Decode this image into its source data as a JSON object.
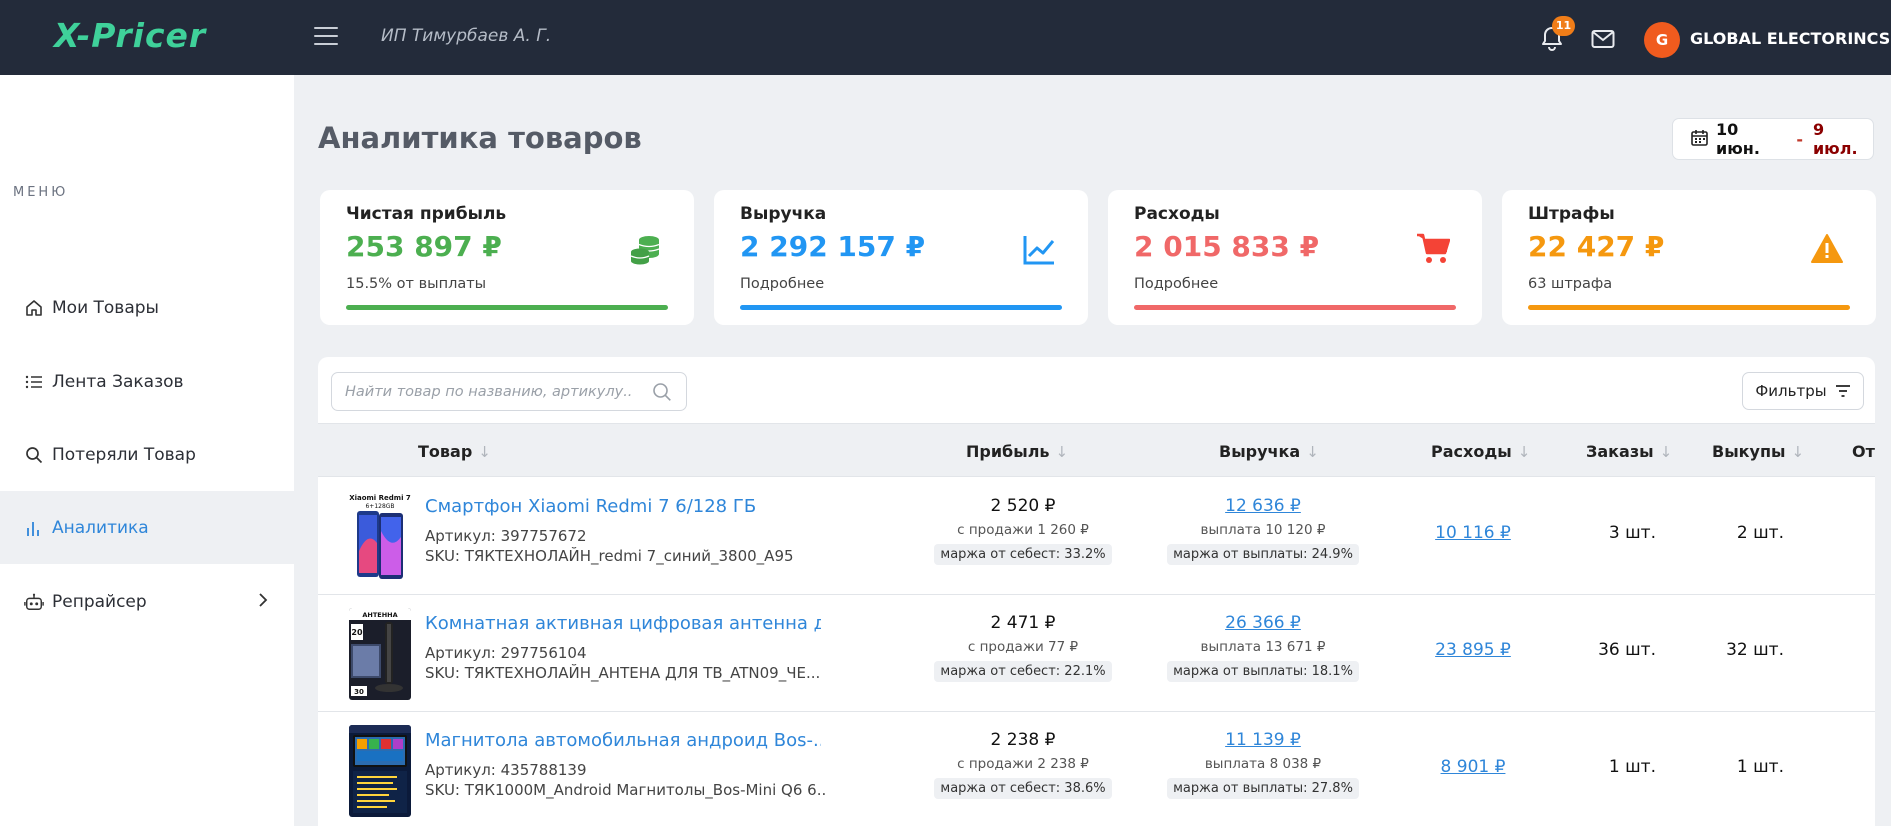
{
  "header": {
    "logo": "X-Pricer",
    "company": "ИП Тимурбаев А. Г.",
    "notifications_count": "11",
    "avatar_letter": "G",
    "user_name": "GLOBAL ELECTORINCS"
  },
  "sidebar": {
    "caption": "МЕНЮ",
    "items": [
      {
        "label": "Мои Товары",
        "icon": "home-icon"
      },
      {
        "label": "Лента Заказов",
        "icon": "list-icon"
      },
      {
        "label": "Потеряли Товар",
        "icon": "search-icon"
      },
      {
        "label": "Аналитика",
        "icon": "bar-chart-icon",
        "active": true
      },
      {
        "label": "Репрайсер",
        "icon": "robot-icon"
      }
    ]
  },
  "page": {
    "title": "Аналитика товаров",
    "date_from": "10 июн.",
    "date_sep": "-",
    "date_to": "9 июл."
  },
  "cards": [
    {
      "title": "Чистая прибыль",
      "value": "253 897 ₽",
      "sub": "15.5% от выплаты",
      "color": "#4caf50",
      "icon": "coins-icon"
    },
    {
      "title": "Выручка",
      "value": "2 292 157 ₽",
      "sub": "Подробнее",
      "color": "#2196f3",
      "icon": "line-chart-icon"
    },
    {
      "title": "Расходы",
      "value": "2 015 833 ₽",
      "sub": "Подробнее",
      "color": "#f06868",
      "icon": "cart-icon"
    },
    {
      "title": "Штрафы",
      "value": "22 427 ₽",
      "sub": "63 штрафа",
      "color": "#f5980f",
      "icon": "warning-icon"
    }
  ],
  "search": {
    "placeholder": "Найти товар по названию, артикулу..."
  },
  "filters_label": "Фильтры",
  "table": {
    "columns": [
      "Товар",
      "Прибыль",
      "Выручка",
      "Расходы",
      "Заказы",
      "Выкупы",
      "Отк"
    ],
    "rows": [
      {
        "name": "Смартфон Xiaomi Redmi 7 6/128 ГБ",
        "article": "Артикул: 397757672",
        "sku": "SKU: ТЯКТЕХНОЛАЙН_redmi 7_синий_3800_А95",
        "profit": "2 520 ₽",
        "profit_sale": "с продажи 1 260 ₽",
        "profit_margin": "маржа от себест: 33.2%",
        "revenue": "12 636 ₽",
        "revenue_payout": "выплата 10 120 ₽",
        "revenue_margin": "маржа от выплаты: 24.9%",
        "expenses": "10 116 ₽",
        "orders": "3 шт.",
        "buyouts": "2 шт."
      },
      {
        "name": "Комнатная активная цифровая антенна д...",
        "article": "Артикул: 297756104",
        "sku": "SKU: ТЯКТЕХНОЛАЙН_АНТЕНА ДЛЯ ТВ_ATN09_ЧЕ...",
        "profit": "2 471 ₽",
        "profit_sale": "с продажи 77 ₽",
        "profit_margin": "маржа от себест: 22.1%",
        "revenue": "26 366 ₽",
        "revenue_payout": "выплата 13 671 ₽",
        "revenue_margin": "маржа от выплаты: 18.1%",
        "expenses": "23 895 ₽",
        "orders": "36 шт.",
        "buyouts": "32 шт."
      },
      {
        "name": "Магнитола автомобильная андроид Bos-...",
        "article": "Артикул: 435788139",
        "sku": "SKU: ТЯК1000М_Android Магнитолы_Bos-Mini Q6 6...",
        "profit": "2 238 ₽",
        "profit_sale": "с продажи 2 238 ₽",
        "profit_margin": "маржа от себест: 38.6%",
        "revenue": "11 139 ₽",
        "revenue_payout": "выплата 8 038 ₽",
        "revenue_margin": "маржа от выплаты: 27.8%",
        "expenses": "8 901 ₽",
        "orders": "1 шт.",
        "buyouts": "1 шт."
      }
    ]
  }
}
